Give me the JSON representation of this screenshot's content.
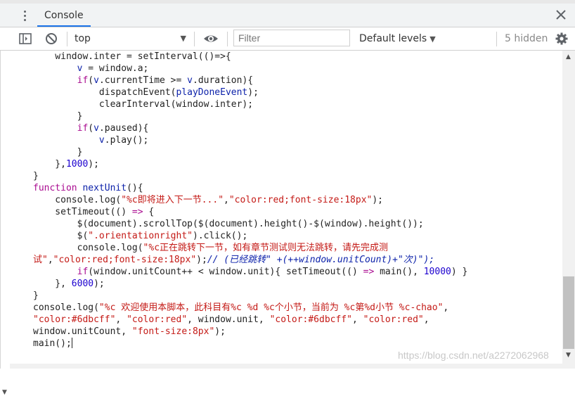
{
  "tabs": {
    "active_label": "Console"
  },
  "toolbar": {
    "context_value": "top",
    "filter_placeholder": "Filter",
    "levels_label": "Default levels",
    "hidden_label": "5 hidden"
  },
  "icons": {
    "menu": "kebab-menu-icon",
    "close": "close-icon",
    "sidebar": "sidebar-toggle-icon",
    "clear": "clear-console-icon",
    "eye": "eye-icon",
    "settings": "gear-icon"
  },
  "colors": {
    "keyword": "#aa0d91",
    "string": "#c41a16",
    "number": "#1c00cf",
    "identifier": "#0d22aa",
    "plain": "#222222",
    "accent": "#1a73e8"
  },
  "code_lines": [
    [
      [
        "    window.inter = setInterval(()=>{",
        "plain"
      ]
    ],
    [
      [
        "        ",
        "plain"
      ],
      [
        "v",
        "identifier"
      ],
      [
        " = window.a;",
        "plain"
      ]
    ],
    [
      [
        "        ",
        "plain"
      ],
      [
        "if",
        "keyword"
      ],
      [
        "(",
        "plain"
      ],
      [
        "v",
        "identifier"
      ],
      [
        ".currentTime >= ",
        "plain"
      ],
      [
        "v",
        "identifier"
      ],
      [
        ".duration){",
        "plain"
      ]
    ],
    [
      [
        "            dispatchEvent(",
        "plain"
      ],
      [
        "playDoneEvent",
        "identifier"
      ],
      [
        ");",
        "plain"
      ]
    ],
    [
      [
        "            clearInterval(window.inter);",
        "plain"
      ]
    ],
    [
      [
        "        }",
        "plain"
      ]
    ],
    [
      [
        "        ",
        "plain"
      ],
      [
        "if",
        "keyword"
      ],
      [
        "(",
        "plain"
      ],
      [
        "v",
        "identifier"
      ],
      [
        ".paused){",
        "plain"
      ]
    ],
    [
      [
        "            ",
        "plain"
      ],
      [
        "v",
        "identifier"
      ],
      [
        ".play();",
        "plain"
      ]
    ],
    [
      [
        "        }",
        "plain"
      ]
    ],
    [
      [
        "    },",
        "plain"
      ],
      [
        "1000",
        "number"
      ],
      [
        ");",
        "plain"
      ]
    ],
    [
      [
        "}",
        "plain"
      ]
    ],
    [
      [
        "function ",
        "keyword"
      ],
      [
        "nextUnit",
        "identifier"
      ],
      [
        "(){",
        "plain"
      ]
    ],
    [
      [
        "    console.log(",
        "plain"
      ],
      [
        "\"%c即将进入下一节...\"",
        "string"
      ],
      [
        ",",
        "plain"
      ],
      [
        "\"color:red;font-size:18px\"",
        "string"
      ],
      [
        ");",
        "plain"
      ]
    ],
    [
      [
        "    setTimeout(() ",
        "plain"
      ],
      [
        "=>",
        "keyword"
      ],
      [
        " {",
        "plain"
      ]
    ],
    [
      [
        "        $(document).scrollTop($(document).height()-$(window).height());",
        "plain"
      ]
    ],
    [
      [
        "        $(",
        "plain"
      ],
      [
        "\".orientationright\"",
        "string"
      ],
      [
        ").click();",
        "plain"
      ]
    ],
    [
      [
        "        console.log(",
        "plain"
      ],
      [
        "\"%c正在跳转下一节，如有章节测试则无法跳转，请先完成测",
        "string"
      ]
    ],
    [
      [
        "试\"",
        "string"
      ],
      [
        ",",
        "plain"
      ],
      [
        "\"color:red;font-size:18px\"",
        "string"
      ],
      [
        ");",
        "plain"
      ],
      [
        "// (已经跳转\" +(++window.unitCount)+\"次)\");",
        "identifier"
      ]
    ],
    [
      [
        "        ",
        "plain"
      ],
      [
        "if",
        "keyword"
      ],
      [
        "(window.unitCount++ < window.unit){ setTimeout(() ",
        "plain"
      ],
      [
        "=>",
        "keyword"
      ],
      [
        " main(), ",
        "plain"
      ],
      [
        "10000",
        "number"
      ],
      [
        ") }",
        "plain"
      ]
    ],
    [
      [
        "    }, ",
        "plain"
      ],
      [
        "6000",
        "number"
      ],
      [
        ");",
        "plain"
      ]
    ],
    [
      [
        "}",
        "plain"
      ]
    ],
    [
      [
        "console.log(",
        "plain"
      ],
      [
        "\"%c 欢迎使用本脚本，此科目有%c %d %c个小节，当前为 %c第%d小节 %c-chao\"",
        "string"
      ],
      [
        ",",
        "plain"
      ]
    ],
    [
      [
        "\"color:#6dbcff\"",
        "string"
      ],
      [
        ", ",
        "plain"
      ],
      [
        "\"color:red\"",
        "string"
      ],
      [
        ", window.unit, ",
        "plain"
      ],
      [
        "\"color:#6dbcff\"",
        "string"
      ],
      [
        ", ",
        "plain"
      ],
      [
        "\"color:red\"",
        "string"
      ],
      [
        ",",
        "plain"
      ]
    ],
    [
      [
        "window.unitCount, ",
        "plain"
      ],
      [
        "\"font-size:8px\"",
        "string"
      ],
      [
        ");",
        "plain"
      ]
    ],
    [
      [
        "main();",
        "plain"
      ]
    ]
  ],
  "watermark": "https://blog.csdn.net/a2272062968"
}
